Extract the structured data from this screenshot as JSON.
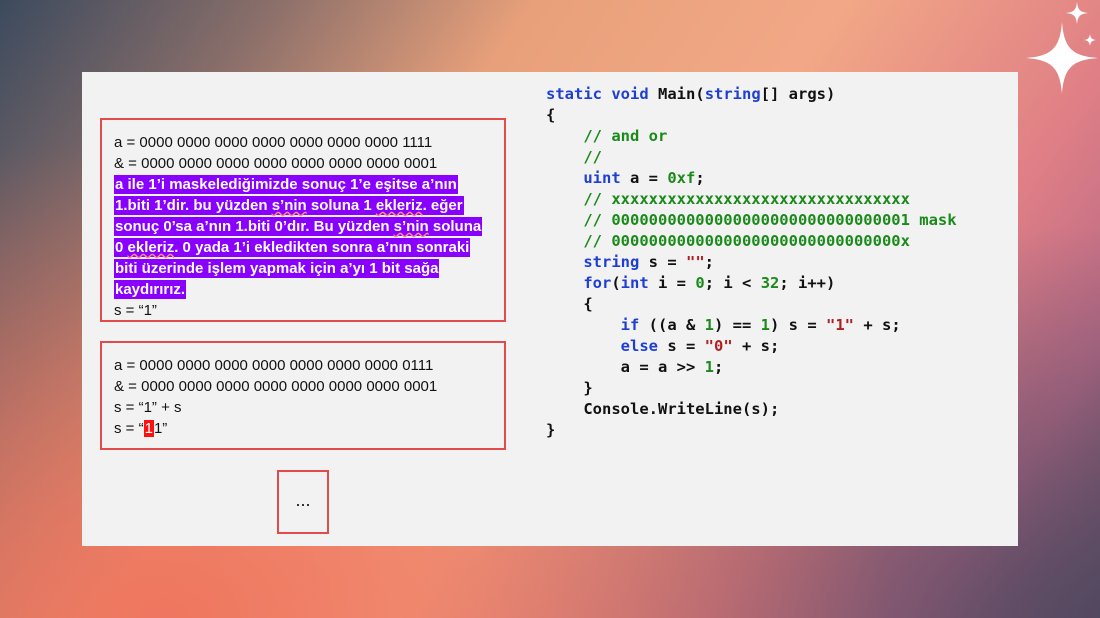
{
  "slide": {
    "box1": {
      "line1": "a = 0000 0000 0000 0000 0000 0000 0000 1111",
      "line2": "& = 0000 0000 0000 0000 0000 0000 0000 0001",
      "highlight_a": "a ile 1’i maskelediğimizde sonuç 1’e eşitse a’nın 1.biti 1’dir. bu yüzden ",
      "highlight_sn1": "s’nin",
      "highlight_b": " soluna 1 ",
      "highlight_ekleriz1": "ekleriz",
      "highlight_c": ". eğer sonuç 0’sa a’nın 1.biti 0’dır. Bu yüzden ",
      "highlight_sn2": "s’nin",
      "highlight_d": " soluna 0 ",
      "highlight_ekleriz2": "ekleriz",
      "highlight_e": ". 0 yada 1’i ekledikten sonra a’nın sonraki biti üzerinde işlem yapmak için a’yı 1 bit sağa kaydırırız.",
      "line_last": "s = “1”"
    },
    "box2": {
      "line1": "a = 0000 0000 0000 0000 0000 0000 0000 0111",
      "line2": "& = 0000 0000 0000 0000 0000 0000 0000 0001",
      "line3": "s = “1” + s",
      "line4_prefix": "s = “",
      "line4_red": "1",
      "line4_suffix": "1”"
    },
    "box3": {
      "text": "..."
    }
  },
  "code": {
    "l1_kw1": "static",
    "l1_kw2": "void",
    "l1_a": "Main(",
    "l1_kw3": "string",
    "l1_b": "[] args)",
    "l2": "{",
    "l3": "    // and or",
    "l4": "    //",
    "l5_kw": "uint",
    "l5_a": " a = ",
    "l5_num": "0xf",
    "l5_b": ";",
    "l6": "    // xxxxxxxxxxxxxxxxxxxxxxxxxxxxxxxx",
    "l7": "    // 00000000000000000000000000000001 mask",
    "l8": "    // 0000000000000000000000000000000x",
    "l9_kw": "string",
    "l9_a": " s = ",
    "l9_str": "\"\"",
    "l9_b": ";",
    "l10_kw1": "for",
    "l10_a": "(",
    "l10_kw2": "int",
    "l10_b": " i = ",
    "l10_n1": "0",
    "l10_c": "; i < ",
    "l10_n2": "32",
    "l10_d": "; i++)",
    "l11": "    {",
    "l12_kw": "if",
    "l12_a": " ((a & ",
    "l12_n1": "1",
    "l12_b": ") == ",
    "l12_n2": "1",
    "l12_c": ") s = ",
    "l12_str": "\"1\"",
    "l12_d": " + s;",
    "l13_kw": "else",
    "l13_a": " s = ",
    "l13_str": "\"0\"",
    "l13_b": " + s;",
    "l14_a": "a = a >> ",
    "l14_n": "1",
    "l14_b": ";",
    "l15": "    }",
    "l16": "    Console.WriteLine(s);",
    "l17": "}"
  },
  "colors": {
    "keyword": "#1f3fd1",
    "comment": "#1b8a1b",
    "string": "#b02020",
    "highlight": "#8a00ff",
    "box_border": "#e24b4b"
  }
}
